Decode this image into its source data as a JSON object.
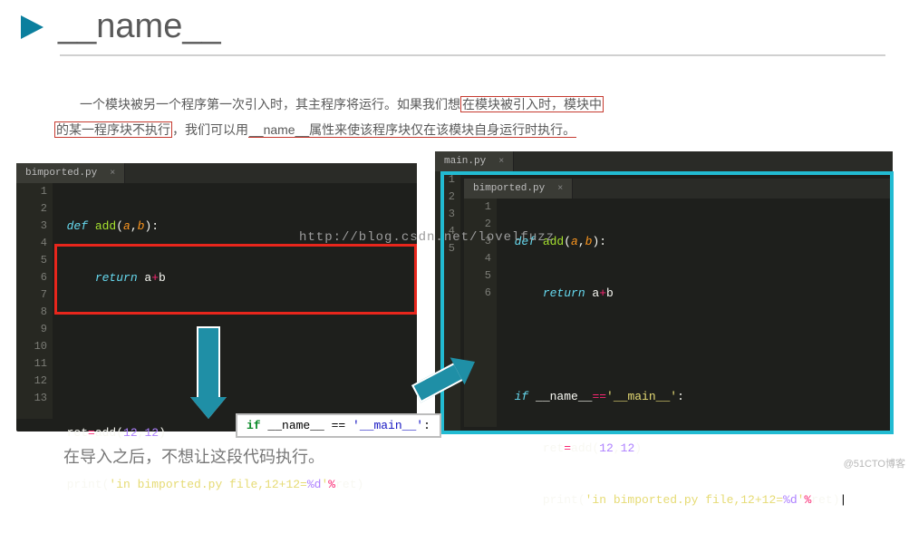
{
  "header": {
    "title": "__name__"
  },
  "paragraph": {
    "t1": "一个模块被另一个程序第一次引入时，其主程序将运行。如果我们想",
    "hl1": "在模块被引入时，模块中",
    "hl2": "的某一程序块不执行",
    "t2": "，我们可以用",
    "underline": "__name__属性来使该程序块仅在该模块自身运行时执行。"
  },
  "editor_left": {
    "tab_label": "bimported.py",
    "line_count": 13,
    "code": {
      "l1": {
        "kw": "def ",
        "fn": "add",
        "paren_open": "(",
        "a": "a",
        "c1": ",",
        "b": "b",
        "paren_close": ")",
        "colon": ":"
      },
      "l2": {
        "kw": "return ",
        "a": "a",
        "op": "+",
        "b": "b"
      },
      "l5": {
        "v": "ret",
        "eq": "=",
        "fn": "add(",
        "n1": "12",
        "c": ",",
        "n2": "12",
        "close": ")"
      },
      "l6": {
        "fn": "print(",
        "s1": "'in bimported.py file,12+12=",
        "s2": "%d",
        "s3": "'",
        "pct": "%",
        "v": "ret",
        "close": ")"
      }
    }
  },
  "editor_right": {
    "top_tab": "main.py",
    "tab_label": "bimported.py",
    "line_count": 6,
    "code": {
      "l1": {
        "kw": "def ",
        "fn": "add",
        "paren_open": "(",
        "a": "a",
        "c1": ",",
        "b": "b",
        "paren_close": ")",
        "colon": ":"
      },
      "l2": {
        "kw": "return ",
        "a": "a",
        "op": "+",
        "b": "b"
      },
      "l4": {
        "kw": "if ",
        "v": "__name__",
        "op": "==",
        "s": "'__main__'",
        "colon": ":"
      },
      "l5": {
        "v": "ret",
        "eq": "=",
        "fn": "add(",
        "n1": "12",
        "c": ",",
        "n2": "12",
        "close": ")"
      },
      "l6": {
        "fn": "print(",
        "s1": "'in bimported.py file,12+12=",
        "s2": "%d",
        "s3": "'",
        "pct": "%",
        "v": "ret",
        "close": ")"
      }
    }
  },
  "snippet": {
    "if": "if",
    "name": " __name__ ",
    "eq": "==",
    "main": " '__main__'",
    "colon": ":"
  },
  "caption": "在导入之后，不想让这段代码执行。",
  "watermark": "http://blog.csdn.net/lovelfuzz",
  "corner": "@51CTO博客"
}
